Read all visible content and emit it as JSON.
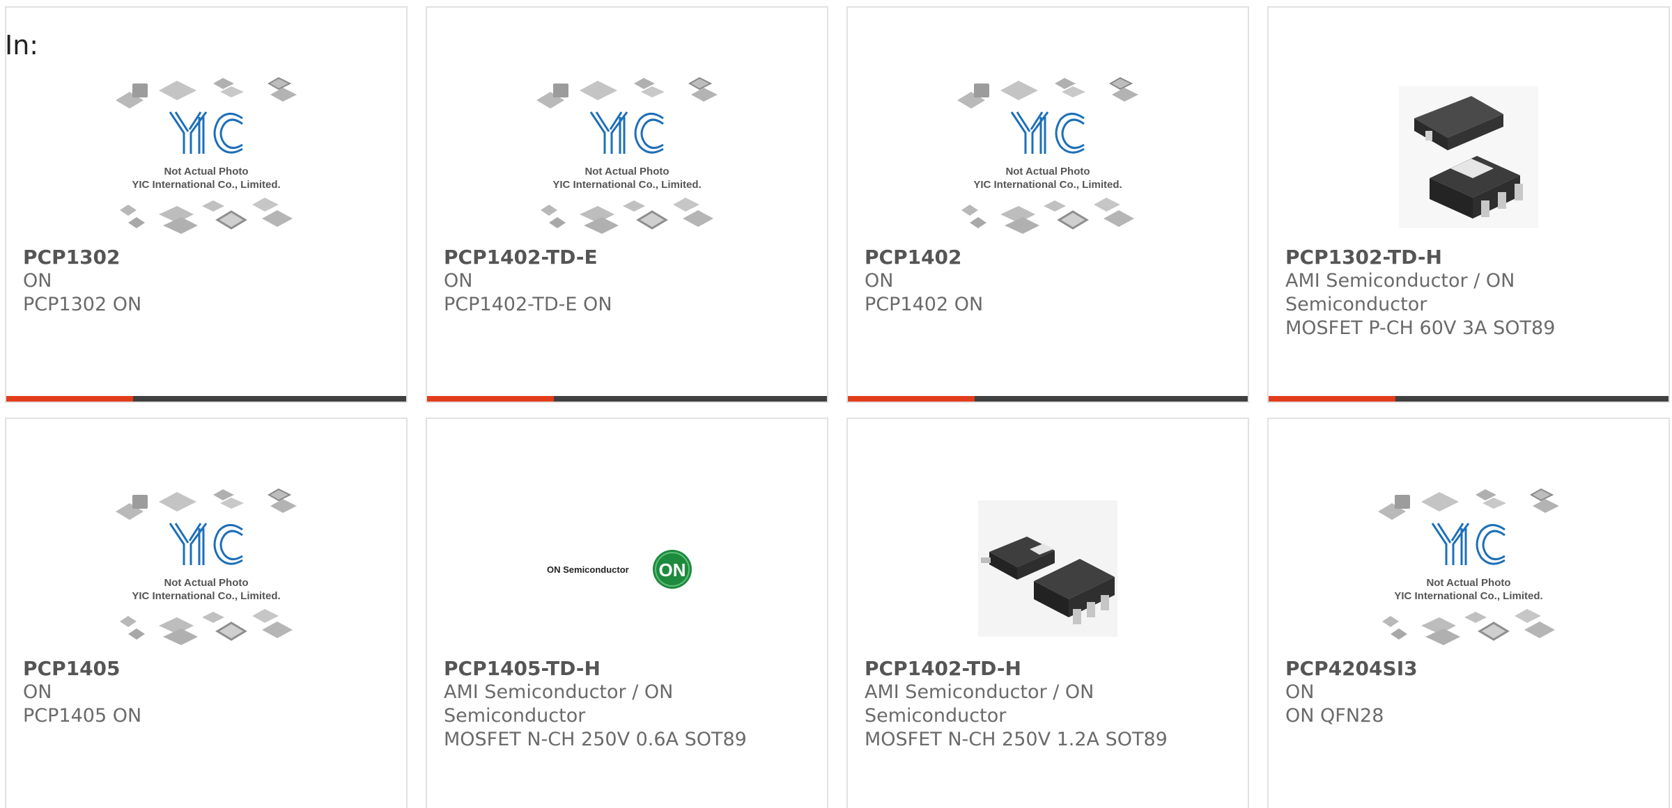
{
  "header": {
    "in_label": "In:"
  },
  "placeholder_image": {
    "line1": "Not Actual Photo",
    "line2": "YIC International Co., Limited."
  },
  "colors": {
    "accent": "#e23c1b",
    "bar": "#404040",
    "border": "#e2e2e2",
    "logo_blue": "#1d6fb8",
    "on_green": "#1e8a3e"
  },
  "products": [
    {
      "part": "PCP1302",
      "manufacturer": "ON",
      "description": "PCP1302 ON",
      "image": "placeholder-photo"
    },
    {
      "part": "PCP1402-TD-E",
      "manufacturer": "ON",
      "description": "PCP1402-TD-E ON",
      "image": "placeholder-photo"
    },
    {
      "part": "PCP1402",
      "manufacturer": "ON",
      "description": "PCP1402 ON",
      "image": "placeholder-photo"
    },
    {
      "part": "PCP1302-TD-H",
      "manufacturer": "AMI Semiconductor / ON Semiconductor",
      "description": "MOSFET P-CH 60V 3A SOT89",
      "image": "sot89-package-photo"
    },
    {
      "part": "PCP1405",
      "manufacturer": "ON",
      "description": "PCP1405 ON",
      "image": "placeholder-photo"
    },
    {
      "part": "PCP1405-TD-H",
      "manufacturer": "AMI Semiconductor / ON Semiconductor",
      "description": "MOSFET N-CH 250V 0.6A SOT89",
      "image": "on-semiconductor-logo",
      "logo_text": "ON Semiconductor",
      "logo_badge": "ON"
    },
    {
      "part": "PCP1402-TD-H",
      "manufacturer": "AMI Semiconductor / ON Semiconductor",
      "description": "MOSFET N-CH 250V 1.2A SOT89",
      "image": "sot89-package-photo"
    },
    {
      "part": "PCP4204SI3",
      "manufacturer": "ON",
      "description": "ON QFN28",
      "image": "placeholder-photo"
    }
  ]
}
